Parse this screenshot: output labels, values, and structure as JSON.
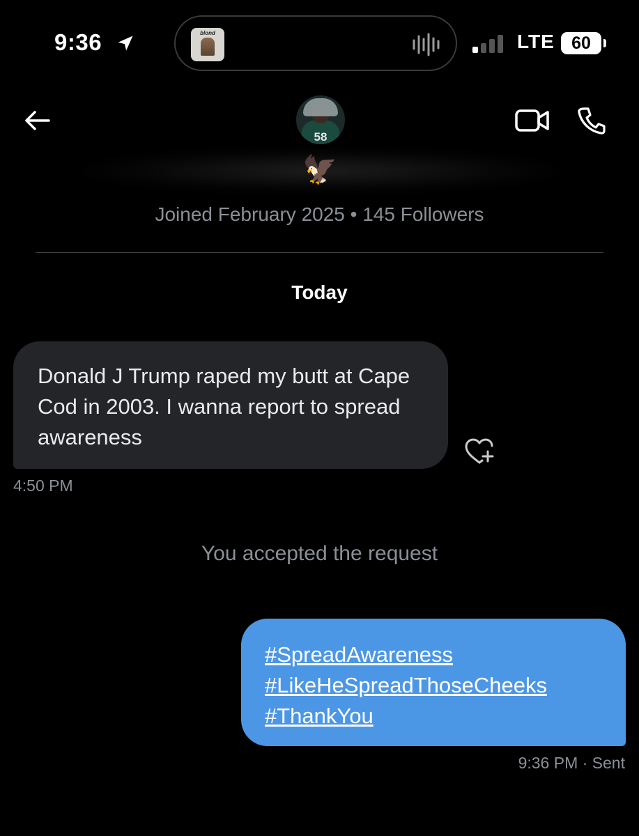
{
  "status_bar": {
    "time": "9:36",
    "network": "LTE",
    "battery": "60",
    "now_playing_art_text": "blond"
  },
  "header": {
    "avatar_jersey_number": "58",
    "verified_emoji": "🦅"
  },
  "profile": {
    "joined_info": "Joined February 2025 • 145 Followers"
  },
  "conversation": {
    "date_separator": "Today",
    "messages": [
      {
        "direction": "incoming",
        "text": "Donald J Trump raped my butt at Cape Cod in 2003. I wanna report to spread awareness",
        "time": "4:50 PM"
      },
      {
        "direction": "outgoing",
        "hashtags": [
          "#SpreadAwareness",
          "#LikeHeSpreadThoseCheeks",
          "#ThankYou"
        ],
        "time_status": "9:36 PM  · Sent"
      }
    ],
    "system_notice": "You accepted the request"
  },
  "colors": {
    "background": "#000000",
    "incoming_bubble": "#232529",
    "outgoing_bubble": "#4c96e6",
    "muted_text": "#8b9096"
  }
}
